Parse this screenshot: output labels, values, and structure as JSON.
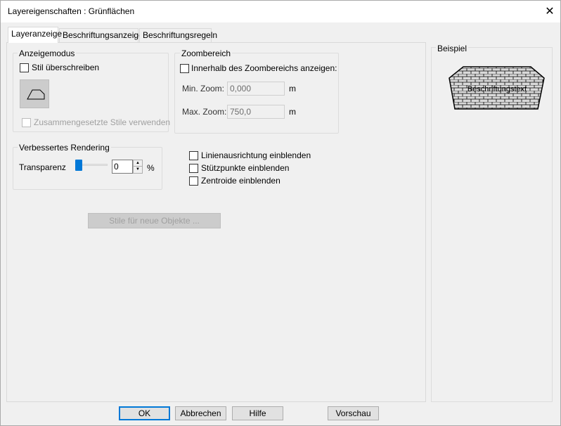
{
  "window": {
    "title": "Layereigenschaften : Grünflächen",
    "close_glyph": "✕"
  },
  "tabs": [
    {
      "label": "Layeranzeige",
      "active": true
    },
    {
      "label": "Beschriftungsanzeige",
      "active": false
    },
    {
      "label": "Beschriftungsregeln",
      "active": false
    }
  ],
  "anzeigemodus": {
    "title": "Anzeigemodus",
    "override_style_label": "Stil überschreiben",
    "override_style_checked": false,
    "composite_styles_label": "Zusammengesetzte Stile verwenden",
    "composite_styles_checked": false,
    "composite_styles_enabled": false
  },
  "zoombereich": {
    "title": "Zoombereich",
    "show_within_label": "Innerhalb des Zoombereichs anzeigen:",
    "show_within_checked": false,
    "min_zoom_label": "Min. Zoom:",
    "min_zoom_value": "0,000",
    "min_zoom_unit": "m",
    "max_zoom_label": "Max. Zoom:",
    "max_zoom_value": "750,0",
    "max_zoom_unit": "m"
  },
  "rendering": {
    "title": "Verbessertes Rendering",
    "transparency_label": "Transparenz",
    "transparency_value": "0",
    "transparency_unit": "%",
    "transparency_level": 0
  },
  "options": [
    {
      "label": "Linienausrichtung einblenden",
      "checked": false
    },
    {
      "label": "Stützpunkte einblenden",
      "checked": false
    },
    {
      "label": "Zentroide einblenden",
      "checked": false
    }
  ],
  "styles_button_label": "Stile für neue Objekte ...",
  "example": {
    "title": "Beispiel",
    "sample_label": "Beschriftungstext",
    "fill_color": "#d9d9d9",
    "stroke_color": "#000000"
  },
  "footer": {
    "ok_label": "OK",
    "cancel_label": "Abbrechen",
    "help_label": "Hilfe",
    "preview_label": "Vorschau"
  },
  "colors": {
    "accent": "#0078d7",
    "background": "#f0f0f0",
    "disabled_text": "#a0a0a0"
  }
}
